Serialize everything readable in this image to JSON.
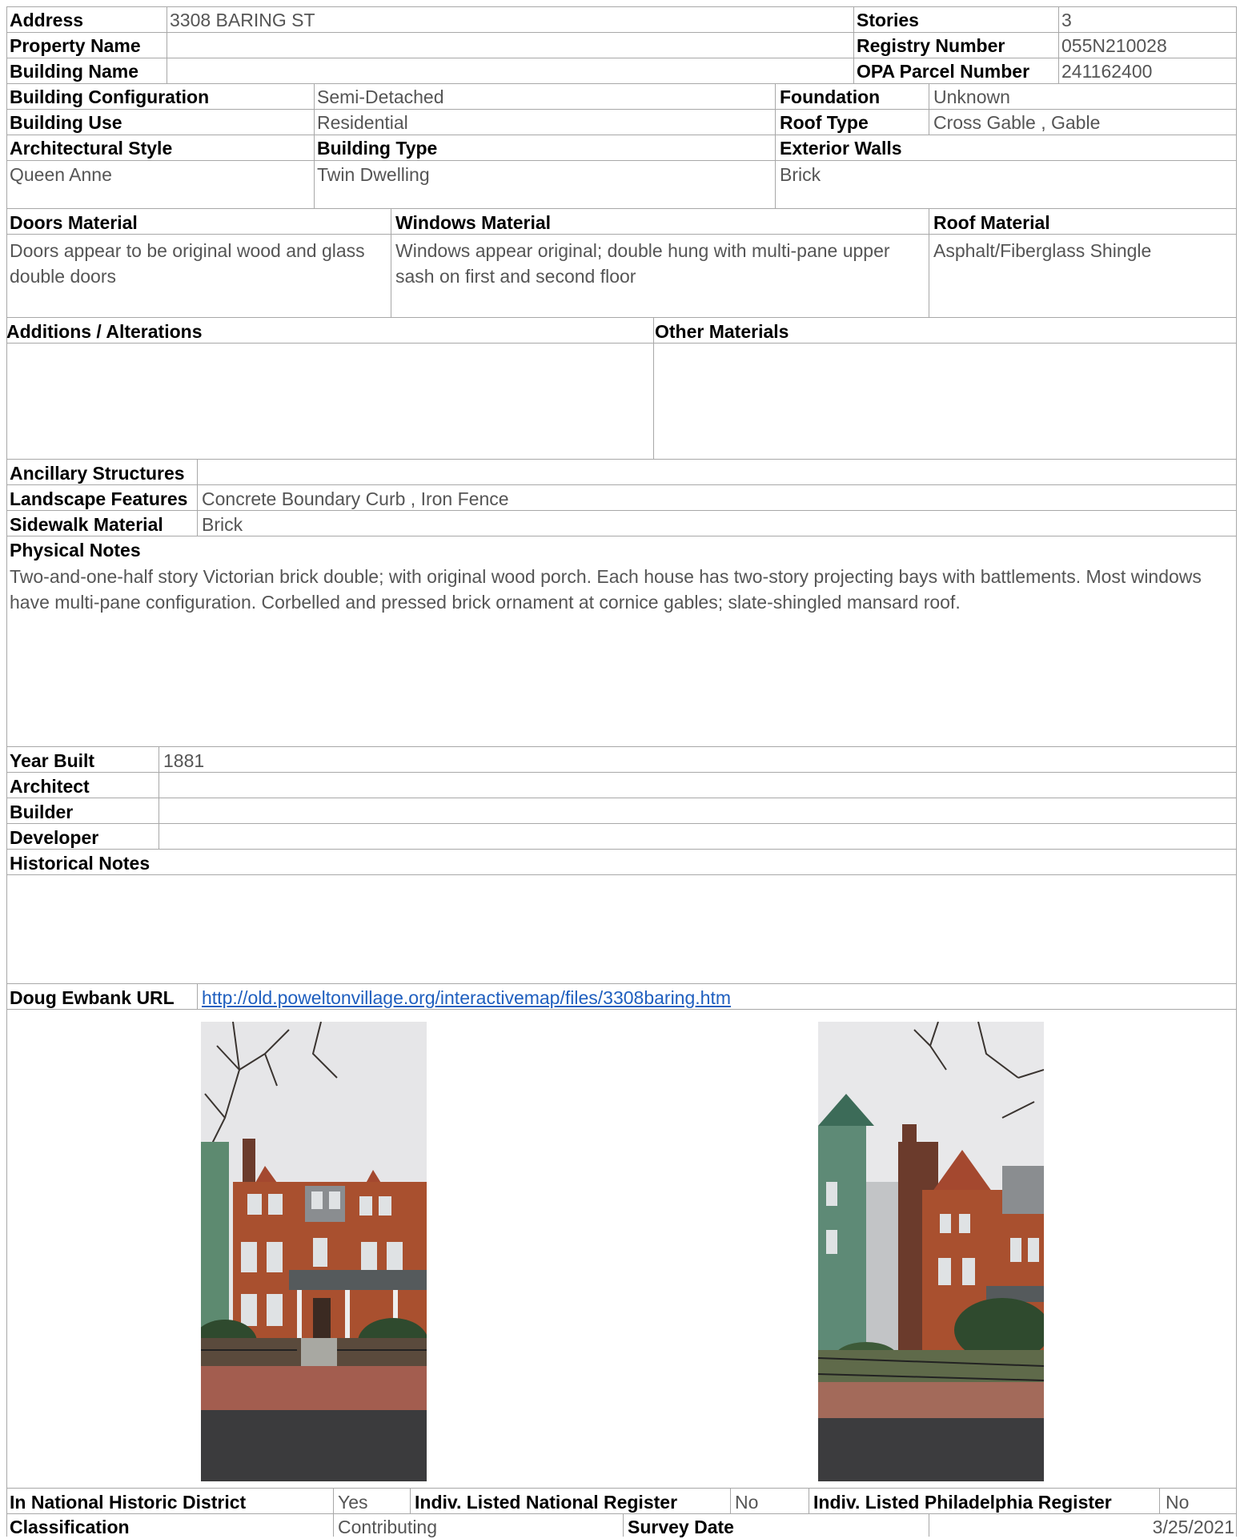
{
  "header": {
    "address_label": "Address",
    "address_value": "3308 BARING ST",
    "stories_label": "Stories",
    "stories_value": "3",
    "property_name_label": "Property Name",
    "property_name_value": "",
    "registry_number_label": "Registry Number",
    "registry_number_value": "055N210028",
    "building_name_label": "Building Name",
    "building_name_value": "",
    "opa_label": "OPA Parcel Number",
    "opa_value": "241162400"
  },
  "details": {
    "config_label": "Building Configuration",
    "config_value": "Semi-Detached",
    "foundation_label": "Foundation",
    "foundation_value": "Unknown",
    "use_label": "Building Use",
    "use_value": "Residential",
    "roof_type_label": "Roof Type",
    "roof_type_value": "Cross Gable , Gable",
    "style_label": "Architectural Style",
    "style_value": "Queen Anne",
    "type_label": "Building Type",
    "type_value": "Twin Dwelling",
    "walls_label": "Exterior Walls",
    "walls_value": "Brick"
  },
  "materials": {
    "doors_label": "Doors Material",
    "doors_value": "Doors appear to be original wood and glass double doors",
    "windows_label": "Windows Material",
    "windows_value": "Windows appear original; double hung with multi-pane upper sash on first and second floor",
    "roof_label": "Roof Material",
    "roof_value": "Asphalt/Fiberglass Shingle",
    "additions_label": "Additions / Alterations",
    "additions_value": "",
    "other_label": "Other Materials",
    "other_value": ""
  },
  "site": {
    "ancillary_label": "Ancillary Structures",
    "ancillary_value": "",
    "landscape_label": "Landscape Features",
    "landscape_value": "Concrete Boundary Curb , Iron Fence",
    "sidewalk_label": "Sidewalk Material",
    "sidewalk_value": "Brick",
    "physical_label": "Physical Notes",
    "physical_value": "Two-and-one-half story Victorian brick double; with original wood porch. Each house has two-story projecting bays with battlements. Most windows have multi-pane configuration. Corbelled and pressed brick ornament at cornice gables; slate-shingled mansard roof."
  },
  "history": {
    "year_label": "Year Built",
    "year_value": "1881",
    "architect_label": "Architect",
    "architect_value": "",
    "builder_label": "Builder",
    "builder_value": "",
    "developer_label": "Developer",
    "developer_value": "",
    "notes_label": "Historical Notes",
    "notes_value": "",
    "url_label": "Doug Ewbank URL",
    "url_value": "http://old.poweltonvillage.org/interactivemap/files/3308baring.htm"
  },
  "footer": {
    "district_label": "In National Historic District",
    "district_value": "Yes",
    "nat_register_label": "Indiv. Listed National Register",
    "nat_register_value": "No",
    "phila_register_label": "Indiv. Listed Philadelphia Register",
    "phila_register_value": "No",
    "classification_label": "Classification",
    "classification_value": "Contributing",
    "survey_label": "Survey Date",
    "survey_value": "3/25/2021"
  },
  "colors": {
    "label": "#000000",
    "value": "#555555",
    "link": "#1f5fbf",
    "rule": "#a8a8a8"
  }
}
